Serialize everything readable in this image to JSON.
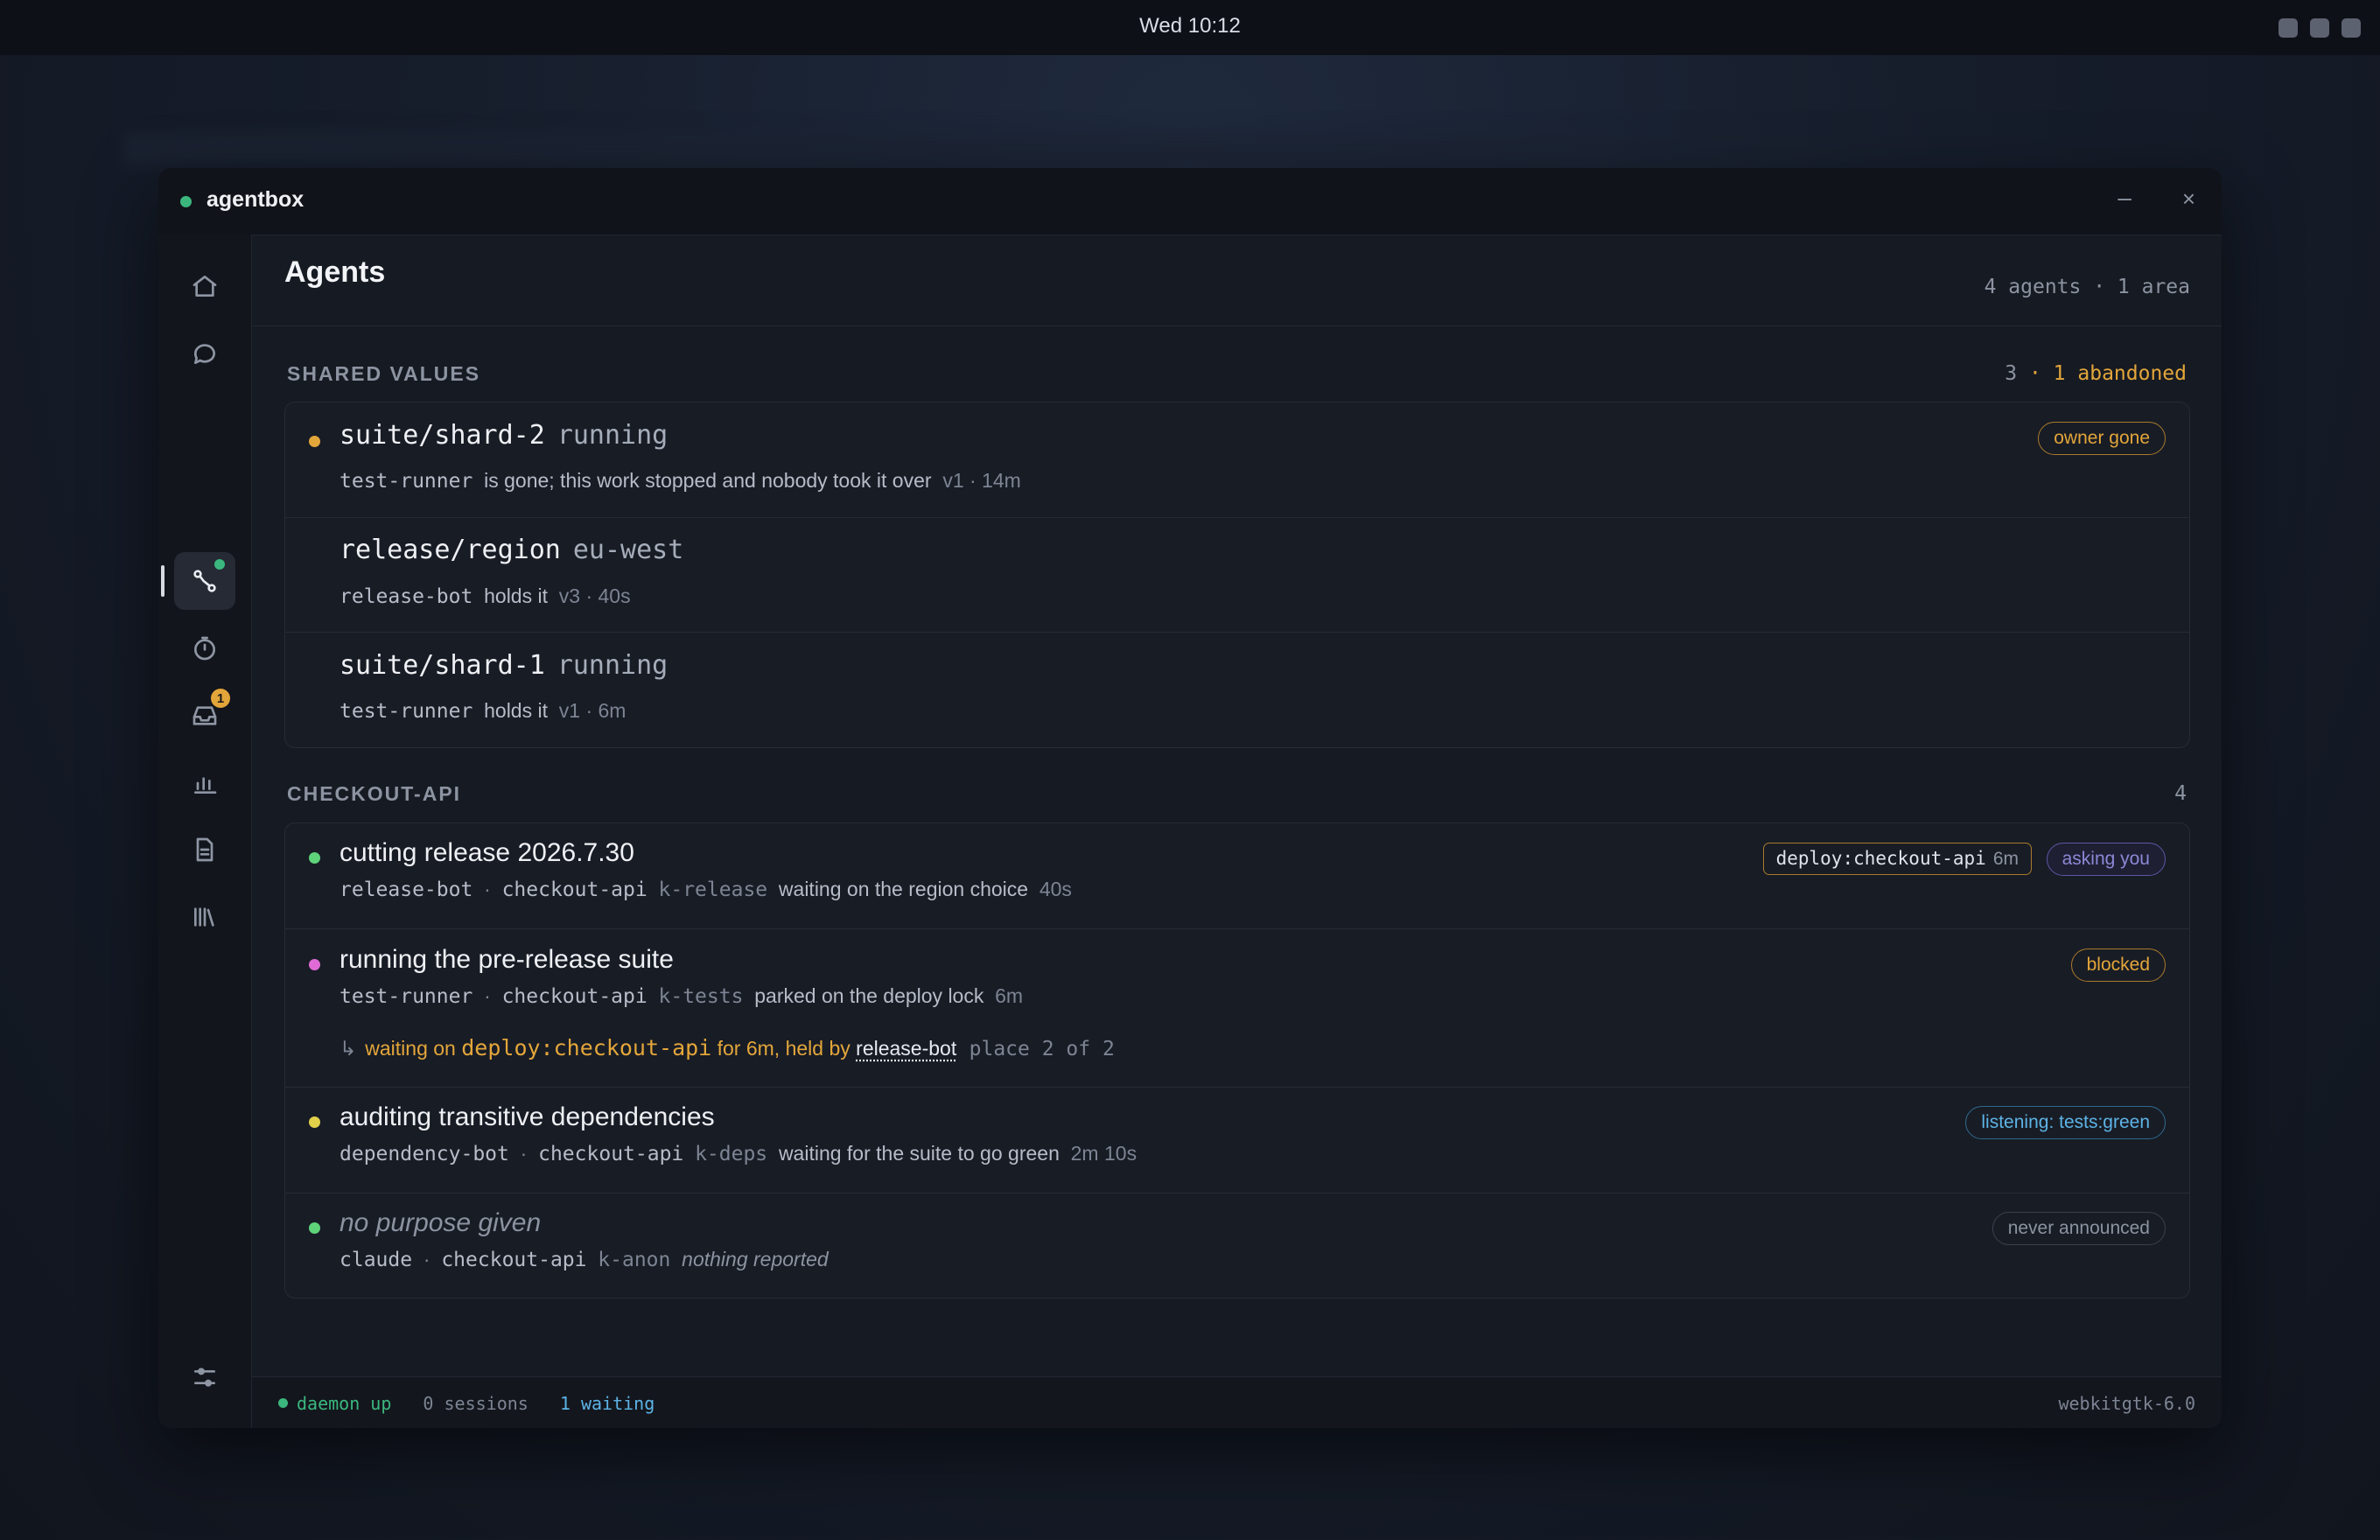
{
  "system_bar": {
    "clock": "Wed 10:12"
  },
  "window": {
    "app_name": "agentbox",
    "minimize_glyph": "–",
    "close_glyph": "×"
  },
  "sidebar": {
    "items": [
      {
        "icon": "home-icon"
      },
      {
        "icon": "chat-icon"
      },
      {
        "icon": "agents-graph-icon",
        "active": true,
        "status_dot": true
      },
      {
        "icon": "timer-icon"
      },
      {
        "icon": "inbox-icon",
        "badge": "1"
      },
      {
        "icon": "chart-icon"
      },
      {
        "icon": "document-icon"
      },
      {
        "icon": "library-icon"
      }
    ],
    "footer_icon": "settings-sliders-icon"
  },
  "page": {
    "title": "Agents",
    "counts": "4 agents · 1 area"
  },
  "shared_values": {
    "label": "SHARED VALUES",
    "count": "3",
    "abandoned": "· 1 abandoned",
    "rows": [
      {
        "key": "suite/shard-2",
        "value": "running",
        "owner": "test-runner",
        "note": "is gone; this work stopped and nobody took it over",
        "meta": "v1 · 14m",
        "badge": "owner gone",
        "bullet": "#e3a63a"
      },
      {
        "key": "release/region",
        "value": "eu-west",
        "owner": "release-bot",
        "note": "holds it",
        "meta": "v3 · 40s"
      },
      {
        "key": "suite/shard-1",
        "value": "running",
        "owner": "test-runner",
        "note": "holds it",
        "meta": "v1 · 6m"
      }
    ]
  },
  "checkout_api": {
    "label": "CHECKOUT-API",
    "count": "4",
    "rows": [
      {
        "purpose": "cutting release 2026.7.30",
        "agent": "release-bot",
        "sep": "·",
        "area": "checkout-api",
        "kind": "k-release",
        "status": "waiting on the region choice",
        "age": "40s",
        "lock_tag": "deploy:checkout-api",
        "lock_age": "6m",
        "badge": "asking you",
        "bullet": "#5fd37a"
      },
      {
        "purpose": "running the pre-release suite",
        "agent": "test-runner",
        "sep": "·",
        "area": "checkout-api",
        "kind": "k-tests",
        "status": "parked on the deploy lock",
        "age": "6m",
        "badge": "blocked",
        "bullet": "#e06bd6",
        "wait": {
          "arrow": "↳",
          "prefix": "waiting on",
          "lock": "deploy:checkout-api",
          "mid": "for 6m, held by",
          "holder": "release-bot",
          "place": "place 2 of 2"
        }
      },
      {
        "purpose": "auditing transitive dependencies",
        "agent": "dependency-bot",
        "sep": "·",
        "area": "checkout-api",
        "kind": "k-deps",
        "status": "waiting for the suite to go green",
        "age": "2m 10s",
        "badge": "listening: tests:green",
        "bullet": "#e3d04a"
      },
      {
        "purpose": "no purpose given",
        "agent": "claude",
        "sep": "·",
        "area": "checkout-api",
        "kind": "k-anon",
        "status": "nothing reported",
        "badge": "never announced",
        "bullet": "#5fd37a"
      }
    ]
  },
  "statusbar": {
    "daemon": "daemon up",
    "sessions": "0 sessions",
    "waiting": "1 waiting",
    "engine": "webkitgtk-6.0"
  },
  "colors": {
    "accent_green": "#3bb77e",
    "amber": "#e3a63a",
    "blue": "#5db3e6",
    "purple": "#8c88d6"
  }
}
